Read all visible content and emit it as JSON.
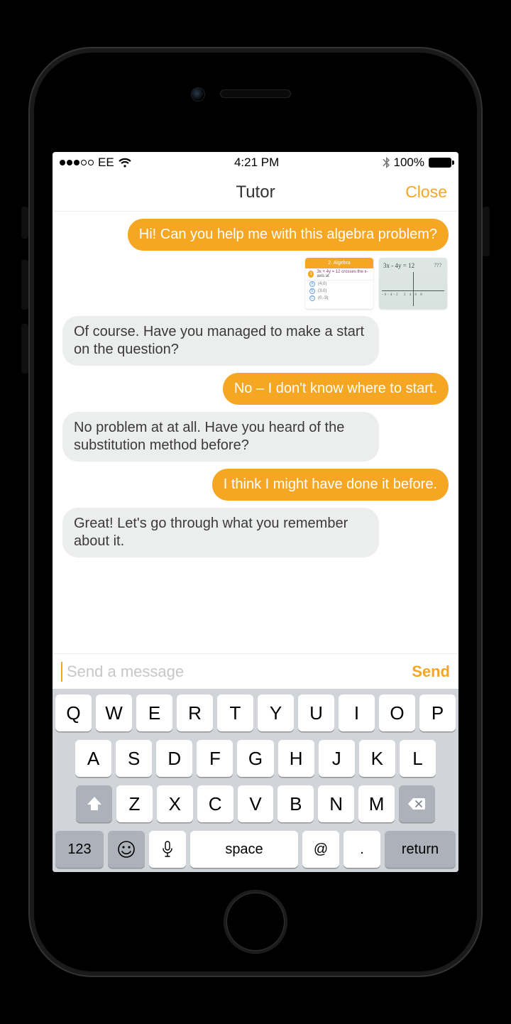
{
  "status_bar": {
    "carrier": "EE",
    "time": "4:21 PM",
    "battery_pct": "100%",
    "signal_filled": 3,
    "signal_total": 5
  },
  "nav": {
    "title": "Tutor",
    "close": "Close"
  },
  "messages": [
    {
      "side": "out",
      "text": "Hi! Can you help me with this algebra problem?"
    },
    {
      "side": "images"
    },
    {
      "side": "in",
      "text": "Of course. Have you managed to make a start on the question?"
    },
    {
      "side": "out",
      "text": "No – I don't know where to start."
    },
    {
      "side": "in",
      "text": "No problem at at all. Have you heard of the substitution method before?"
    },
    {
      "side": "out",
      "text": "I think I might have done it before."
    },
    {
      "side": "in",
      "text": "Great! Let's go through what you remember about it."
    }
  ],
  "attachments": {
    "quiz_header": "2. Algebra",
    "quiz_prompt": "3x + 4y = 12 crosses the x-axis at",
    "graph_equation": "3x - 4y = 12",
    "graph_qmark": "???"
  },
  "compose": {
    "placeholder": "Send a message",
    "value": "",
    "send": "Send"
  },
  "keyboard": {
    "row1": [
      "Q",
      "W",
      "E",
      "R",
      "T",
      "Y",
      "U",
      "I",
      "O",
      "P"
    ],
    "row2": [
      "A",
      "S",
      "D",
      "F",
      "G",
      "H",
      "J",
      "K",
      "L"
    ],
    "row3": [
      "Z",
      "X",
      "C",
      "V",
      "B",
      "N",
      "M"
    ],
    "numkey": "123",
    "space": "space",
    "at": "@",
    "dot": ".",
    "return": "return"
  },
  "colors": {
    "accent": "#f5a623",
    "bubble_in": "#eceded",
    "kb_bg": "#d1d4d9",
    "kb_fn": "#acb1ba"
  }
}
